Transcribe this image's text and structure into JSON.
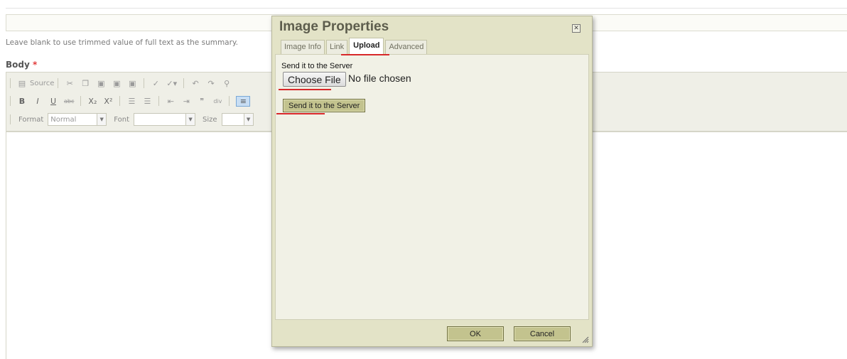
{
  "page": {
    "summary_help": "Leave blank to use trimmed value of full text as the summary.",
    "body_label": "Body",
    "required_mark": "*"
  },
  "toolbar": {
    "source_label": "Source",
    "format_label": "Format",
    "format_value": "Normal",
    "font_label": "Font",
    "font_value": "",
    "size_label": "Size",
    "size_value": ""
  },
  "dialog": {
    "title": "Image Properties",
    "close_glyph": "✕",
    "tabs": [
      {
        "label": "Image Info",
        "active": false
      },
      {
        "label": "Link",
        "active": false
      },
      {
        "label": "Upload",
        "active": true
      },
      {
        "label": "Advanced",
        "active": false
      }
    ],
    "upload_label": "Send it to the Server",
    "choose_file": "Choose File",
    "no_file": "No file chosen",
    "send_button": "Send it to the Server",
    "ok": "OK",
    "cancel": "Cancel"
  },
  "colors": {
    "accent_underline": "#d8282a",
    "dialog_bg": "#e3e3c7",
    "button_bg": "#c3c38e"
  }
}
